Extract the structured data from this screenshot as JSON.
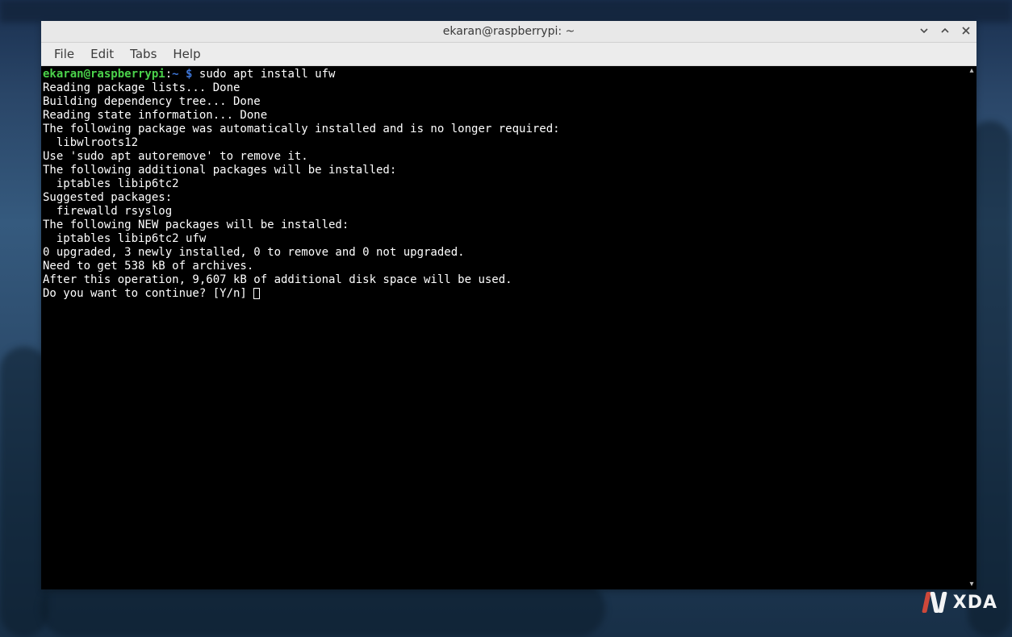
{
  "window": {
    "title": "ekaran@raspberrypi: ~"
  },
  "menubar": {
    "file": "File",
    "edit": "Edit",
    "tabs": "Tabs",
    "help": "Help"
  },
  "prompt": {
    "user_host": "ekaran@raspberrypi",
    "colon": ":",
    "path": "~",
    "dollar": "$",
    "command": " sudo apt install ufw"
  },
  "output": {
    "l1": "Reading package lists... Done",
    "l2": "Building dependency tree... Done",
    "l3": "Reading state information... Done",
    "l4": "The following package was automatically installed and is no longer required:",
    "l5": "  libwlroots12",
    "l6": "Use 'sudo apt autoremove' to remove it.",
    "l7": "The following additional packages will be installed:",
    "l8": "  iptables libip6tc2",
    "l9": "Suggested packages:",
    "l10": "  firewalld rsyslog",
    "l11": "The following NEW packages will be installed:",
    "l12": "  iptables libip6tc2 ufw",
    "l13": "0 upgraded, 3 newly installed, 0 to remove and 0 not upgraded.",
    "l14": "Need to get 538 kB of archives.",
    "l15": "After this operation, 9,607 kB of additional disk space will be used.",
    "l16": "Do you want to continue? [Y/n] "
  },
  "watermark": {
    "text": "XDA"
  }
}
